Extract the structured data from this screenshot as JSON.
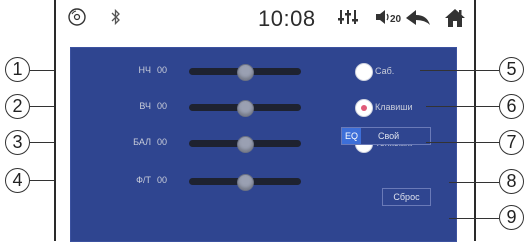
{
  "statusbar": {
    "time": "10:08",
    "volume": "20"
  },
  "sliders": [
    {
      "label": "НЧ",
      "value": "00",
      "level": 0.5
    },
    {
      "label": "ВЧ",
      "value": "00",
      "level": 0.5
    },
    {
      "label": "БАЛ",
      "value": "00",
      "level": 0.5
    },
    {
      "label": "Ф/Т",
      "value": "00",
      "level": 0.5
    }
  ],
  "options": [
    {
      "label": "Саб.",
      "selected": false
    },
    {
      "label": "Клавиши",
      "selected": true
    },
    {
      "label": "Тонкомп.",
      "selected": false
    }
  ],
  "eq": {
    "tag": "EQ",
    "preset": "Свой"
  },
  "reset_label": "Сброс",
  "callouts": [
    "1",
    "2",
    "3",
    "4",
    "5",
    "6",
    "7",
    "8",
    "9"
  ],
  "colors": {
    "panel": "#2f4590",
    "accent": "#3d6fd8",
    "selected_dot": "#e05a78"
  }
}
